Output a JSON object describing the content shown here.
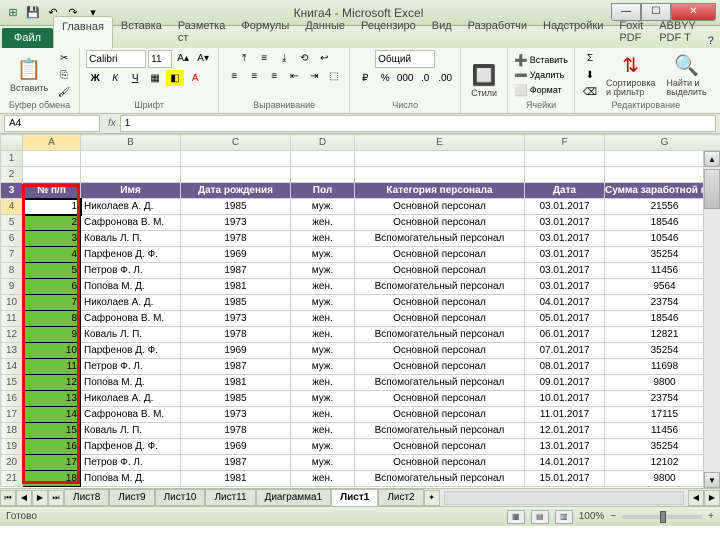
{
  "title": "Книга4 - Microsoft Excel",
  "qa": {
    "save": "💾",
    "undo": "↶",
    "redo": "↷"
  },
  "file_tab": "Файл",
  "tabs": [
    "Главная",
    "Вставка",
    "Разметка ст",
    "Формулы",
    "Данные",
    "Рецензиро",
    "Вид",
    "Разработчи",
    "Надстройки",
    "Foxit PDF",
    "ABBYY PDF T"
  ],
  "active_tab_index": 0,
  "ribbon": {
    "clipboard": {
      "paste": "Вставить",
      "label": "Буфер обмена"
    },
    "font": {
      "name": "Calibri",
      "size": "11",
      "label": "Шрифт"
    },
    "align": {
      "label": "Выравнивание"
    },
    "number": {
      "format": "Общий",
      "label": "Число"
    },
    "styles": {
      "btn": "Стили",
      "label": ""
    },
    "cells": {
      "insert": "Вставить",
      "delete": "Удалить",
      "format": "Формат",
      "label": "Ячейки"
    },
    "editing": {
      "sort": "Сортировка\nи фильтр",
      "find": "Найти и\nвыделить",
      "label": "Редактирование"
    }
  },
  "name_box": "A4",
  "formula": "1",
  "columns": [
    "A",
    "B",
    "C",
    "D",
    "E",
    "F",
    "G"
  ],
  "header_row_index": 3,
  "headers": [
    "№ п/п",
    "Имя",
    "Дата рождения",
    "Пол",
    "Категория персонала",
    "Дата",
    "Сумма заработной платы"
  ],
  "data": [
    {
      "n": 1,
      "name": "Николаев А. Д.",
      "birth": "1985",
      "sex": "муж.",
      "cat": "Основной персонал",
      "date": "03.01.2017",
      "sum": "21556"
    },
    {
      "n": 2,
      "name": "Сафронова В. М.",
      "birth": "1973",
      "sex": "жен.",
      "cat": "Основной персонал",
      "date": "03.01.2017",
      "sum": "18546"
    },
    {
      "n": 3,
      "name": "Коваль Л. П.",
      "birth": "1978",
      "sex": "жен.",
      "cat": "Вспомогательный персонал",
      "date": "03.01.2017",
      "sum": "10546"
    },
    {
      "n": 4,
      "name": "Парфенов Д. Ф.",
      "birth": "1969",
      "sex": "муж.",
      "cat": "Основной персонал",
      "date": "03.01.2017",
      "sum": "35254"
    },
    {
      "n": 5,
      "name": "Петров Ф. Л.",
      "birth": "1987",
      "sex": "муж.",
      "cat": "Основной персонал",
      "date": "03.01.2017",
      "sum": "11456"
    },
    {
      "n": 6,
      "name": "Попова М. Д.",
      "birth": "1981",
      "sex": "жен.",
      "cat": "Вспомогательный персонал",
      "date": "03.01.2017",
      "sum": "9564"
    },
    {
      "n": 7,
      "name": "Николаев А. Д.",
      "birth": "1985",
      "sex": "муж.",
      "cat": "Основной персонал",
      "date": "04.01.2017",
      "sum": "23754"
    },
    {
      "n": 8,
      "name": "Сафронова В. М.",
      "birth": "1973",
      "sex": "жен.",
      "cat": "Основной персонал",
      "date": "05.01.2017",
      "sum": "18546"
    },
    {
      "n": 9,
      "name": "Коваль Л. П.",
      "birth": "1978",
      "sex": "жен.",
      "cat": "Вспомогательный персонал",
      "date": "06.01.2017",
      "sum": "12821"
    },
    {
      "n": 10,
      "name": "Парфенов Д. Ф.",
      "birth": "1969",
      "sex": "муж.",
      "cat": "Основной персонал",
      "date": "07.01.2017",
      "sum": "35254"
    },
    {
      "n": 11,
      "name": "Петров Ф. Л.",
      "birth": "1987",
      "sex": "муж.",
      "cat": "Основной персонал",
      "date": "08.01.2017",
      "sum": "11698"
    },
    {
      "n": 12,
      "name": "Попова М. Д.",
      "birth": "1981",
      "sex": "жен.",
      "cat": "Вспомогательный персонал",
      "date": "09.01.2017",
      "sum": "9800"
    },
    {
      "n": 13,
      "name": "Николаев А. Д.",
      "birth": "1985",
      "sex": "муж.",
      "cat": "Основной персонал",
      "date": "10.01.2017",
      "sum": "23754"
    },
    {
      "n": 14,
      "name": "Сафронова В. М.",
      "birth": "1973",
      "sex": "жен.",
      "cat": "Основной персонал",
      "date": "11.01.2017",
      "sum": "17115"
    },
    {
      "n": 15,
      "name": "Коваль Л. П.",
      "birth": "1978",
      "sex": "жен.",
      "cat": "Вспомогательный персонал",
      "date": "12.01.2017",
      "sum": "11456"
    },
    {
      "n": 16,
      "name": "Парфенов Д. Ф.",
      "birth": "1969",
      "sex": "муж.",
      "cat": "Основной персонал",
      "date": "13.01.2017",
      "sum": "35254"
    },
    {
      "n": 17,
      "name": "Петров Ф. Л.",
      "birth": "1987",
      "sex": "муж.",
      "cat": "Основной персонал",
      "date": "14.01.2017",
      "sum": "12102"
    },
    {
      "n": 18,
      "name": "Попова М. Д.",
      "birth": "1981",
      "sex": "жен.",
      "cat": "Вспомогательный персонал",
      "date": "15.01.2017",
      "sum": "9800"
    }
  ],
  "sheets": [
    "Лист8",
    "Лист9",
    "Лист10",
    "Лист11",
    "Диаграмма1",
    "Лист1",
    "Лист2"
  ],
  "active_sheet_index": 5,
  "status": {
    "ready": "Готово",
    "zoom": "100%"
  },
  "win": {
    "min": "—",
    "max": "☐",
    "close": "✕"
  }
}
